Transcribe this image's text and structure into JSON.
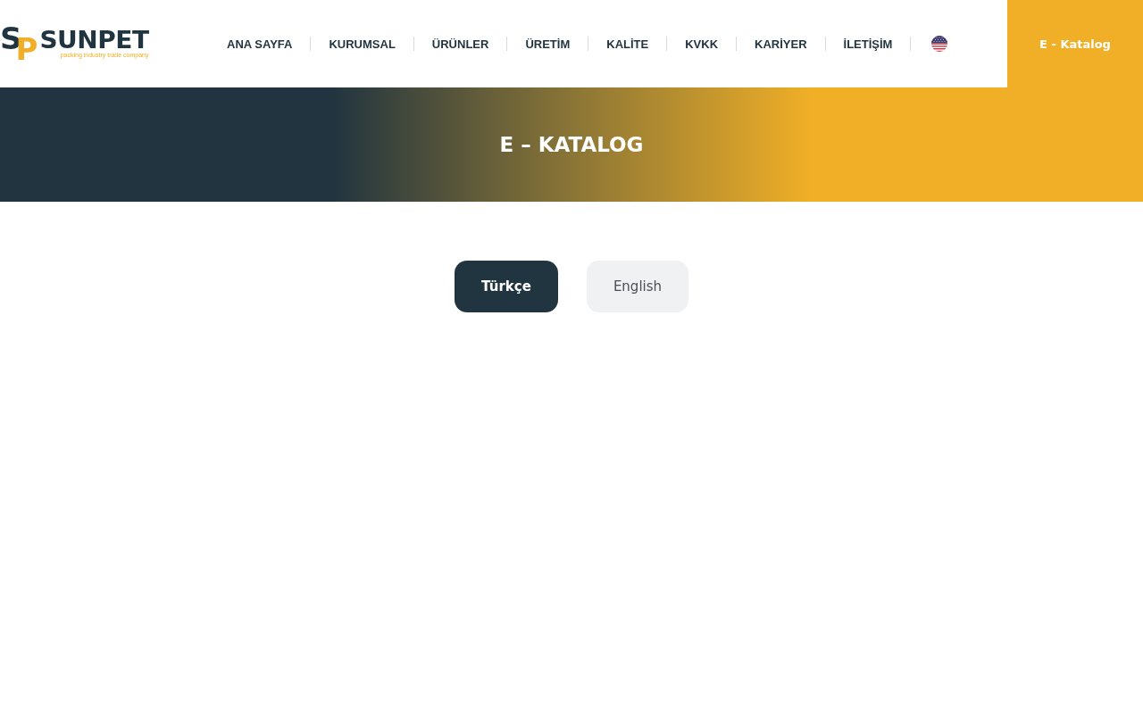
{
  "header": {
    "logo": {
      "monogram": [
        {
          "letter": "S",
          "color": "#213540"
        },
        {
          "letter": "P",
          "color": "#f0af27"
        }
      ],
      "name": "SUNPET",
      "tagline": "packing industry trade company"
    },
    "nav": [
      "ANA SAYFA",
      "KURUMSAL",
      "ÜRÜNLER",
      "ÜRETİM",
      "KALİTE",
      "KVKK",
      "KARİYER",
      "İLETİŞİM"
    ],
    "cta": "E - Katalog"
  },
  "hero": {
    "title": "E – KATALOG"
  },
  "language_buttons": [
    {
      "label": "Türkçe",
      "selected": true
    },
    {
      "label": "English",
      "selected": false
    }
  ]
}
